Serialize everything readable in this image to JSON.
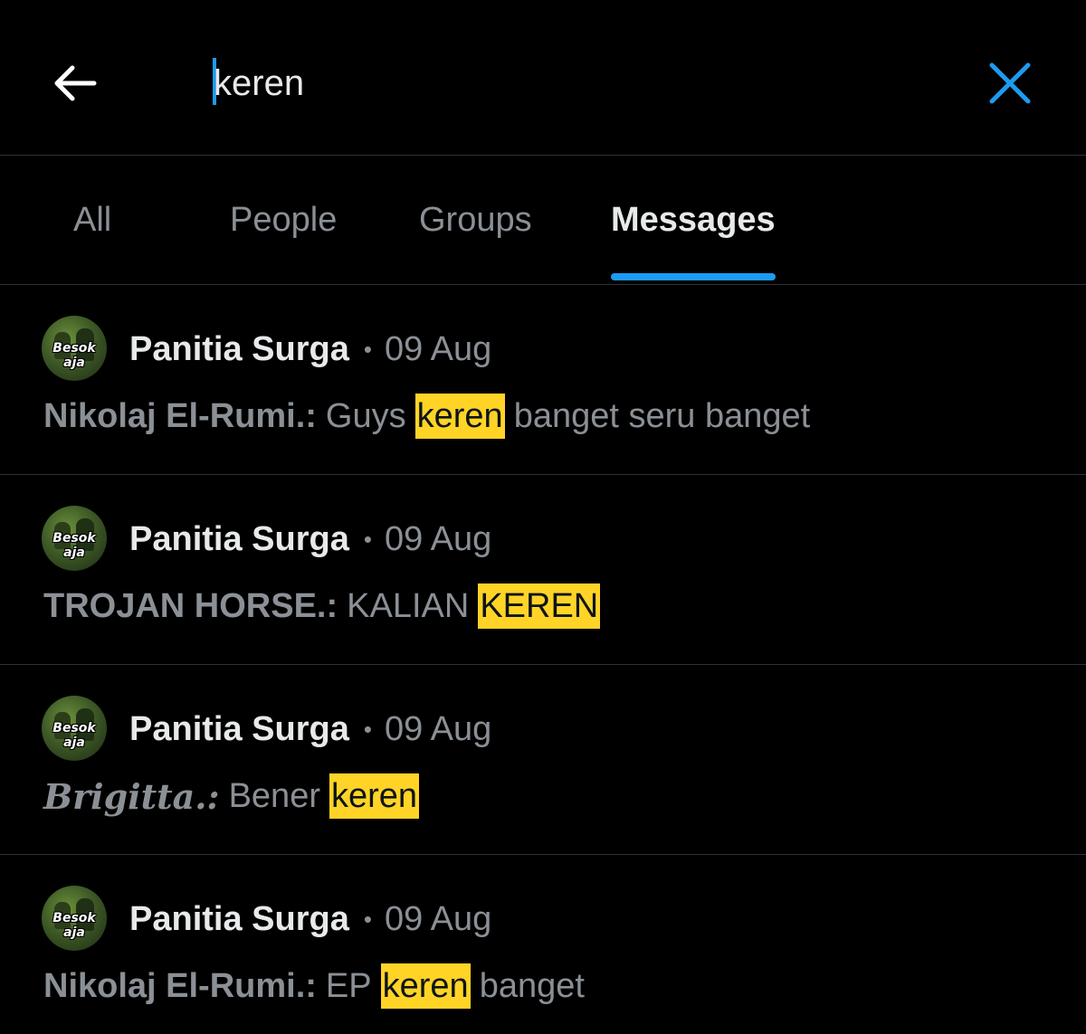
{
  "search": {
    "value": "keren"
  },
  "tabs": [
    {
      "label": "All",
      "active": false
    },
    {
      "label": "People",
      "active": false
    },
    {
      "label": "Groups",
      "active": false
    },
    {
      "label": "Messages",
      "active": true
    }
  ],
  "icons": {
    "back": "arrow-left-icon",
    "clear": "close-icon"
  },
  "colors": {
    "accent": "#1d9bf0",
    "highlight": "#ffd426",
    "background": "#000000",
    "muted_text": "#8b9096"
  },
  "results": [
    {
      "avatar_text": "Besok aja",
      "group": "Panitia Surga",
      "separator": "•",
      "date": "09 Aug",
      "sender": "Nikolaj El-Rumi.:",
      "before": "Guys",
      "match": "keren",
      "after": "banget seru banget"
    },
    {
      "avatar_text": "Besok aja",
      "group": "Panitia Surga",
      "separator": "•",
      "date": "09 Aug",
      "sender": "TROJAN HORSE.:",
      "before": "KALIAN",
      "match": "KEREN",
      "after": ""
    },
    {
      "avatar_text": "Besok aja",
      "group": "Panitia Surga",
      "separator": "•",
      "date": "09 Aug",
      "sender": "Brigitta.:",
      "before": "Bener",
      "match": "keren",
      "after": ""
    },
    {
      "avatar_text": "Besok aja",
      "group": "Panitia Surga",
      "separator": "•",
      "date": "09 Aug",
      "sender": "Nikolaj El-Rumi.:",
      "before": "EP",
      "match": "keren",
      "after": "banget"
    }
  ]
}
